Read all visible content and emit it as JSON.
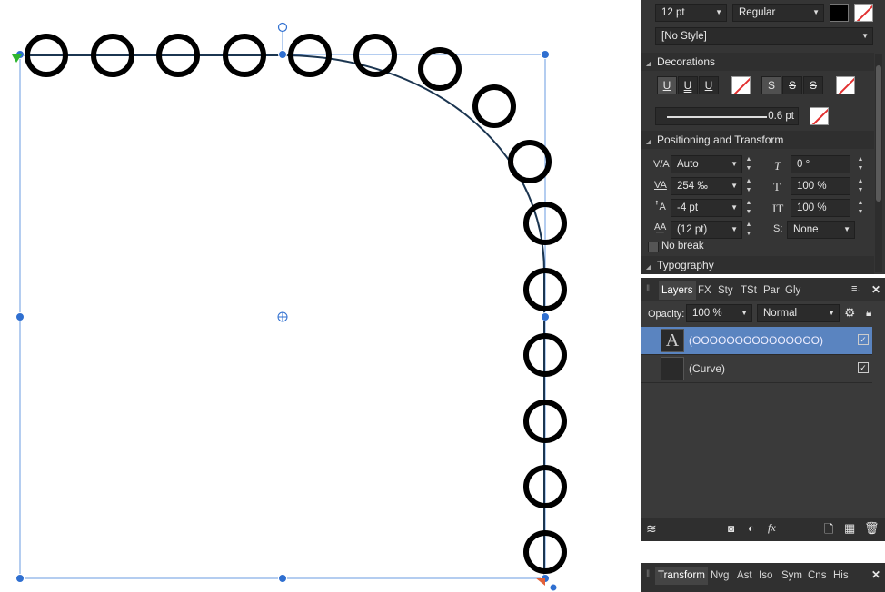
{
  "character": {
    "font_size": "12 pt",
    "font_weight": "Regular",
    "fill_color": "#000000",
    "style": "[No Style]",
    "decorations_title": "Decorations",
    "underline_labels": [
      "U",
      "U",
      "U"
    ],
    "strike_labels": [
      "S",
      "S",
      "S"
    ],
    "line_weight": "0.6 pt",
    "positioning_title": "Positioning and Transform",
    "kerning": "Auto",
    "tracking": "254 ‰",
    "baseline": "-4 pt",
    "leading": "(12 pt)",
    "shear": "0 °",
    "horizontal_scale": "100 %",
    "vertical_scale": "100 %",
    "script": "None",
    "no_break": "No break",
    "typography_title": "Typography"
  },
  "layers": {
    "tabs": [
      "Layers",
      "FX",
      "Sty",
      "TSt",
      "Par",
      "Gly"
    ],
    "opacity_label": "Opacity:",
    "opacity_value": "100 %",
    "blend_mode": "Normal",
    "items": [
      {
        "name": "(OOOOOOOOOOOOOOO)",
        "thumb": "A",
        "selected": true,
        "visible": true
      },
      {
        "name": "(Curve)",
        "thumb": "",
        "selected": false,
        "visible": true
      }
    ]
  },
  "transform_panel": {
    "tabs": [
      "Transform",
      "Nvg",
      "Ast",
      "Iso",
      "Sym",
      "Cns",
      "His"
    ]
  },
  "colors": {
    "panel_bg": "#353535",
    "selection": "#5a84c0",
    "handle": "#2f6fd0"
  }
}
